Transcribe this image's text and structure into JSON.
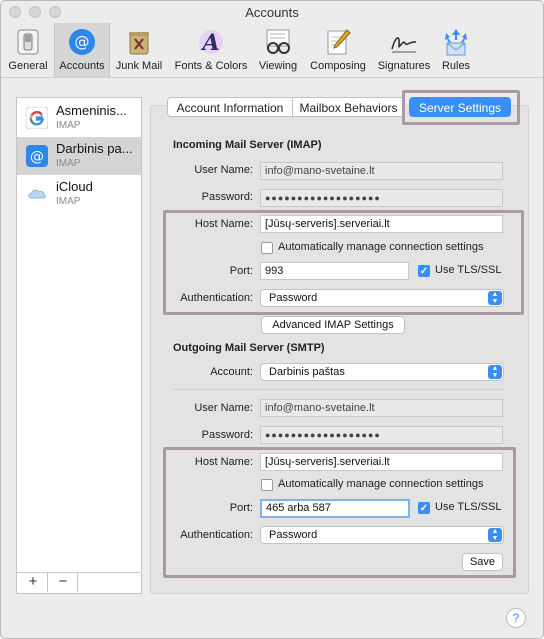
{
  "window": {
    "title": "Accounts"
  },
  "toolbar": {
    "items": [
      {
        "label": "General",
        "icon": "general-switch-icon"
      },
      {
        "label": "Accounts",
        "icon": "at-sign-icon"
      },
      {
        "label": "Junk Mail",
        "icon": "trash-can-icon"
      },
      {
        "label": "Fonts & Colors",
        "icon": "fonts-colors-icon"
      },
      {
        "label": "Viewing",
        "icon": "glasses-icon"
      },
      {
        "label": "Composing",
        "icon": "pencil-paper-icon"
      },
      {
        "label": "Signatures",
        "icon": "signature-icon"
      },
      {
        "label": "Rules",
        "icon": "rules-envelope-icon"
      }
    ],
    "selected": "Accounts"
  },
  "sidebar": {
    "accounts": [
      {
        "name": "Asmeninis...",
        "type": "IMAP",
        "icon": "google-icon"
      },
      {
        "name": "Darbinis pa...",
        "type": "IMAP",
        "icon": "at-sign-icon"
      },
      {
        "name": "iCloud",
        "type": "IMAP",
        "icon": "icloud-icon"
      }
    ],
    "add_label": "+",
    "remove_label": "−"
  },
  "tabs": [
    {
      "label": "Account Information"
    },
    {
      "label": "Mailbox Behaviors"
    },
    {
      "label": "Server Settings"
    }
  ],
  "incoming": {
    "heading": "Incoming Mail Server (IMAP)",
    "user_name_label": "User Name:",
    "user_name": "info@mano-svetaine.lt",
    "password_label": "Password:",
    "password": "●●●●●●●●●●●●●●●●●●",
    "host_name_label": "Host Name:",
    "host_name": "[Jūsų-serveris].serveriai.lt",
    "auto_manage_label": "Automatically manage connection settings",
    "port_label": "Port:",
    "port": "993",
    "tls_label": "Use TLS/SSL",
    "auth_label": "Authentication:",
    "auth": "Password",
    "advanced_button": "Advanced IMAP Settings"
  },
  "outgoing": {
    "heading": "Outgoing Mail Server (SMTP)",
    "account_label": "Account:",
    "account": "Darbinis paštas",
    "user_name_label": "User Name:",
    "user_name": "info@mano-svetaine.lt",
    "password_label": "Password:",
    "password": "●●●●●●●●●●●●●●●●●●",
    "host_name_label": "Host Name:",
    "host_name": "[Jūsų-serveris].serveriai.lt",
    "auto_manage_label": "Automatically manage connection settings",
    "port_label": "Port:",
    "port": "465 arba 587",
    "tls_label": "Use TLS/SSL",
    "auth_label": "Authentication:",
    "auth": "Password",
    "save_button": "Save"
  },
  "help_label": "?",
  "colors": {
    "accent": "#3b8ef4",
    "highlight_box": "#a79aa4"
  }
}
